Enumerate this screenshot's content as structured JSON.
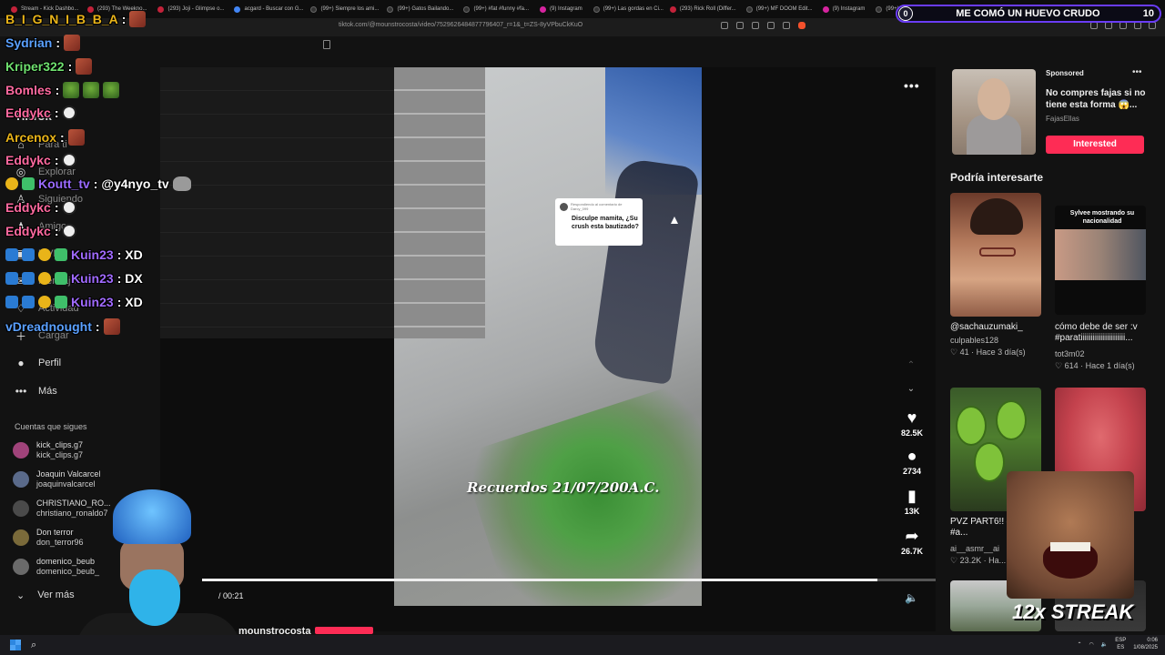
{
  "browser": {
    "tabs": [
      {
        "label": "Stream - Kick Dashbo...",
        "icon": "kick-favicon"
      },
      {
        "label": "(293) The Weekno...",
        "icon": "youtube-favicon"
      },
      {
        "label": "(293) Joji - Glimpse o...",
        "icon": "youtube-favicon"
      },
      {
        "label": "acgard - Buscar con G...",
        "icon": "google-favicon"
      },
      {
        "label": "(99+) Siempre los ami...",
        "icon": "tiktok-favicon"
      },
      {
        "label": "(99+) Gatos Bailando...",
        "icon": "tiktok-favicon"
      },
      {
        "label": "(99+) #fat #funny #fa...",
        "icon": "tiktok-favicon"
      },
      {
        "label": "(9) Instagram",
        "icon": "instagram-favicon"
      },
      {
        "label": "(99+) Las gordas en Ci...",
        "icon": "tiktok-favicon"
      },
      {
        "label": "(293) Rick Roll (Differ...",
        "icon": "youtube-favicon"
      },
      {
        "label": "(99+) MF DOOM Edit...",
        "icon": "tiktok-favicon"
      },
      {
        "label": "(9) Instagram",
        "icon": "instagram-favicon"
      },
      {
        "label": "(99+) Las gorda...",
        "icon": "tiktok-favicon"
      }
    ],
    "url": "tiktok.com/@mounstrocosta/video/7529626484877796407_r=1&_t=ZS-8yVPbuCkKuO"
  },
  "stream_goal": {
    "left_count": "0",
    "label": "ME COMÓ UN HUEVO CRUDO",
    "right_count": "10"
  },
  "chat": [
    {
      "user": "B_I_G_N_I_B_B_A",
      "color": "#e9b419",
      "message": ":",
      "emotes": [
        "red"
      ],
      "badges": []
    },
    {
      "user": "Sydrian",
      "color": "#5aa0ff",
      "message": ":",
      "emotes": [
        "red"
      ],
      "badges": []
    },
    {
      "user": "Kriper322",
      "color": "#6fe06f",
      "message": ":",
      "emotes": [
        "red"
      ],
      "badges": []
    },
    {
      "user": "Bomles",
      "color": "#ff6aa0",
      "message": ":",
      "emotes": [
        "frog",
        "frog",
        "frog"
      ],
      "badges": []
    },
    {
      "user": "Eddykc",
      "color": "#ff6aa0",
      "message": ":",
      "emotes": [
        "skull"
      ],
      "badges": []
    },
    {
      "user": "Arcenox",
      "color": "#e9b419",
      "message": ":",
      "emotes": [
        "red"
      ],
      "badges": []
    },
    {
      "user": "Eddykc",
      "color": "#ff6aa0",
      "message": ":",
      "emotes": [
        "skull"
      ],
      "badges": []
    },
    {
      "user": "Koutt_tv",
      "color": "#9a6aff",
      "message": ": @y4nyo_tv",
      "emotes": [
        "cat"
      ],
      "badges": [
        "gold",
        "green"
      ]
    },
    {
      "user": "Eddykc",
      "color": "#ff6aa0",
      "message": ":",
      "emotes": [
        "skull"
      ],
      "badges": []
    },
    {
      "user": "Eddykc",
      "color": "#ff6aa0",
      "message": ":",
      "emotes": [
        "skull"
      ],
      "badges": []
    },
    {
      "user": "Kuin23",
      "color": "#a06aff",
      "message": ": XD",
      "emotes": [],
      "badges": [
        "blue",
        "blue",
        "gold",
        "green"
      ]
    },
    {
      "user": "Kuin23",
      "color": "#a06aff",
      "message": ": DX",
      "emotes": [],
      "badges": [
        "blue",
        "blue",
        "gold",
        "green"
      ]
    },
    {
      "user": "Kuin23",
      "color": "#a06aff",
      "message": ": XD",
      "emotes": [],
      "badges": [
        "blue",
        "blue",
        "gold",
        "green"
      ]
    },
    {
      "user": "vDreadnought",
      "color": "#5aa0ff",
      "message": ":",
      "emotes": [
        "red"
      ],
      "badges": []
    }
  ],
  "sidebar": {
    "logo": "TikTok",
    "items": [
      {
        "label": "Para ti",
        "icon": "home-icon"
      },
      {
        "label": "Explorar",
        "icon": "compass-icon"
      },
      {
        "label": "Siguiendo",
        "icon": "following-icon"
      },
      {
        "label": "Amigos",
        "icon": "friends-icon"
      },
      {
        "label": "LIVE",
        "icon": "live-icon"
      },
      {
        "label": "Mensajes",
        "icon": "message-icon"
      },
      {
        "label": "Actividad",
        "icon": "activity-icon"
      },
      {
        "label": "Cargar",
        "icon": "plus-icon"
      },
      {
        "label": "Perfil",
        "icon": "profile-icon"
      },
      {
        "label": "Más",
        "icon": "more-icon"
      }
    ],
    "following_title": "Cuentas que sigues",
    "following": [
      {
        "name": "kick_clips.g7",
        "user": "kick_clips.g7"
      },
      {
        "name": "Joaquin Valcarcel",
        "user": "joaquinvalcarcel"
      },
      {
        "name": "CHRISTIANO_RO...",
        "user": "christiano_ronaldo7"
      },
      {
        "name": "Don terror",
        "user": "don_terror96"
      },
      {
        "name": "domenico_beub",
        "user": "domenico_beub_"
      }
    ],
    "see_more": "Ver más"
  },
  "video": {
    "comment_header": "Respondiendo al comentario de Darcy_099",
    "comment_text": "Disculpe mamita, ¿Su crush esta bautizado?",
    "caption": "Recuerdos 21/07/200A.C.",
    "time": "/ 00:21",
    "progress": 0.92,
    "author": "mounstrocosta",
    "actions": [
      {
        "icon": "heart-icon",
        "count": "82.5K"
      },
      {
        "icon": "comment-icon",
        "count": "2734"
      },
      {
        "icon": "bookmark-icon",
        "count": "13K"
      },
      {
        "icon": "share-icon",
        "count": "26.7K"
      }
    ]
  },
  "ad": {
    "sponsored": "Sponsored",
    "title": "No compres fajas si no tiene esta forma 😱...",
    "brand": "FajasEllas",
    "button": "Interested"
  },
  "recommendations": {
    "title": "Podría interesarte",
    "cards": [
      {
        "title": "",
        "user": "@sachauzumaki_",
        "sub": "culpables128",
        "likes": "41",
        "age": "Hace 3 día(s)"
      },
      {
        "title": "cómo debe de ser :v #paratiiiiiiiiiiiiiiiiiiiiii...",
        "user": "",
        "sub": "tot3m02",
        "likes": "614",
        "age": "Hace 1 día(s)",
        "thumb_caption": "Sylvee mostrando su nacionalidad"
      },
      {
        "title": "PVZ PART6!! #asmr #AI #a...",
        "user": "",
        "sub": "ai__asmr__ai",
        "likes": "23.2K",
        "age": "Ha..."
      }
    ]
  },
  "overlays": {
    "streak": "12x STREAK"
  },
  "taskbar": {
    "lang_top": "ESP",
    "lang_bottom": "ES",
    "time": "0:06",
    "date": "1/08/2025"
  }
}
